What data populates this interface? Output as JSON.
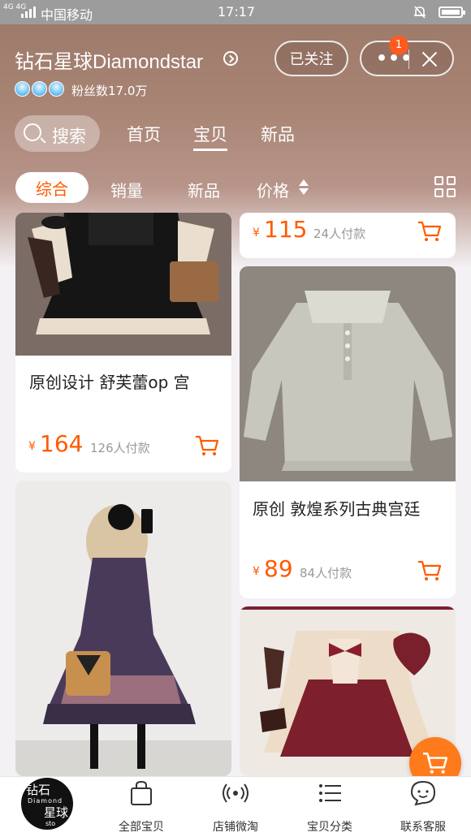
{
  "status_bar": {
    "network": "4G 4G",
    "carrier": "中国移动",
    "time": "17:17"
  },
  "shop": {
    "name": "钻石星球Diamondstar",
    "fans": "粉丝数17.0万",
    "follow_label": "已关注",
    "more_label": "•••",
    "notification_count": "1"
  },
  "nav": {
    "search_label": "搜索",
    "tabs": [
      {
        "label": "首页",
        "active": false
      },
      {
        "label": "宝贝",
        "active": true
      },
      {
        "label": "新品",
        "active": false
      }
    ]
  },
  "sort": {
    "items": [
      "综合",
      "销量",
      "新品",
      "价格"
    ],
    "active": "综合"
  },
  "products": [
    {
      "title": "原创设计 舒芙蕾op 宫",
      "currency": "¥",
      "price": "164",
      "sold": "126人付款"
    },
    {
      "title": "",
      "currency": "¥",
      "price": "115",
      "sold": "24人付款"
    },
    {
      "title": "原创 敦煌系列古典宫廷",
      "currency": "¥",
      "price": "89",
      "sold": "84人付款"
    }
  ],
  "logo": {
    "line1": "钻石",
    "line2": "Diamond",
    "line3": "星球",
    "line4": "sto"
  },
  "bottom_bar": {
    "items": [
      {
        "label": "全部宝贝",
        "icon": "bag-icon"
      },
      {
        "label": "店铺微淘",
        "icon": "broadcast-icon"
      },
      {
        "label": "宝贝分类",
        "icon": "list-icon"
      },
      {
        "label": "联系客服",
        "icon": "chat-icon"
      }
    ]
  },
  "colors": {
    "accent": "#ff5a00",
    "header_top": "#9a7868",
    "badge": "#ff5a1f"
  }
}
